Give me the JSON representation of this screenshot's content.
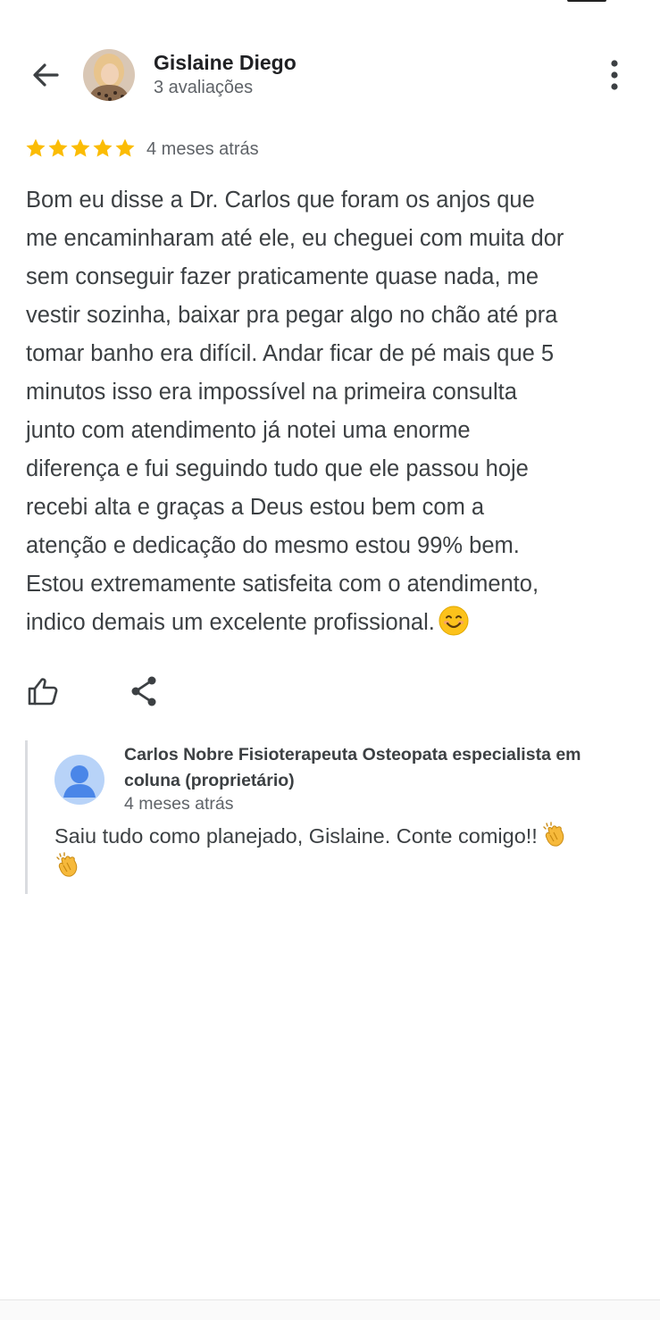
{
  "header": {
    "reviewer_name": "Gislaine Diego",
    "review_count": "3 avaliações",
    "back_icon": "arrow-left-icon",
    "menu_icon": "more-vertical-icon"
  },
  "review": {
    "rating": 5,
    "rating_max": 5,
    "star_color": "#fbbc04",
    "time": "4 meses atrás",
    "lines": [
      "Bom eu disse a Dr. Carlos que foram os anjos que",
      "me encaminharam até ele, eu cheguei com muita dor",
      "sem conseguir fazer praticamente quase nada, me",
      "vestir sozinha, baixar pra pegar algo no chão até pra",
      "tomar banho era difícil. Andar ficar de pé mais que 5",
      "minutos isso era impossível na primeira consulta",
      "junto com atendimento já notei uma enorme",
      "diferença e fui seguindo tudo que ele passou hoje",
      "recebi alta e graças a Deus estou bem com a",
      "atenção e dedicação do mesmo estou 99% bem.",
      "Estou extremamente satisfeita com o atendimento,",
      "indico demais um excelente profissional."
    ],
    "end_emoji": "smiling-face-emoji"
  },
  "actions": {
    "like_icon": "thumbs-up-icon",
    "share_icon": "share-icon"
  },
  "reply": {
    "owner_name": "Carlos Nobre Fisioterapeuta Osteopata especialista em coluna (proprietário)",
    "time": "4 meses atrás",
    "text": "Saiu tudo como planejado, Gislaine. Conte comigo!!",
    "end_emoji": "clapping-hands-emoji"
  }
}
